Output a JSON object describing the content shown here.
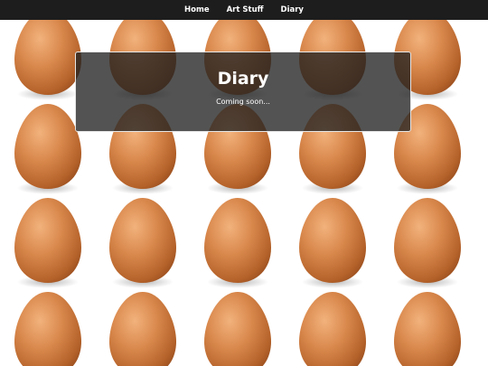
{
  "nav": {
    "items": [
      {
        "label": "Home"
      },
      {
        "label": "Art Stuff"
      },
      {
        "label": "Diary"
      }
    ]
  },
  "overlay": {
    "title": "Diary",
    "message": "Coming soon..."
  },
  "background": {
    "pattern": "egg-icon",
    "tile_columns": 5,
    "tile_rows": 4
  },
  "colors": {
    "navbar": "#1d1d1d",
    "nav_text": "#ffffff",
    "overlay": "#232323",
    "overlay_border": "#e6e6e6",
    "egg": "#d07a3e"
  }
}
